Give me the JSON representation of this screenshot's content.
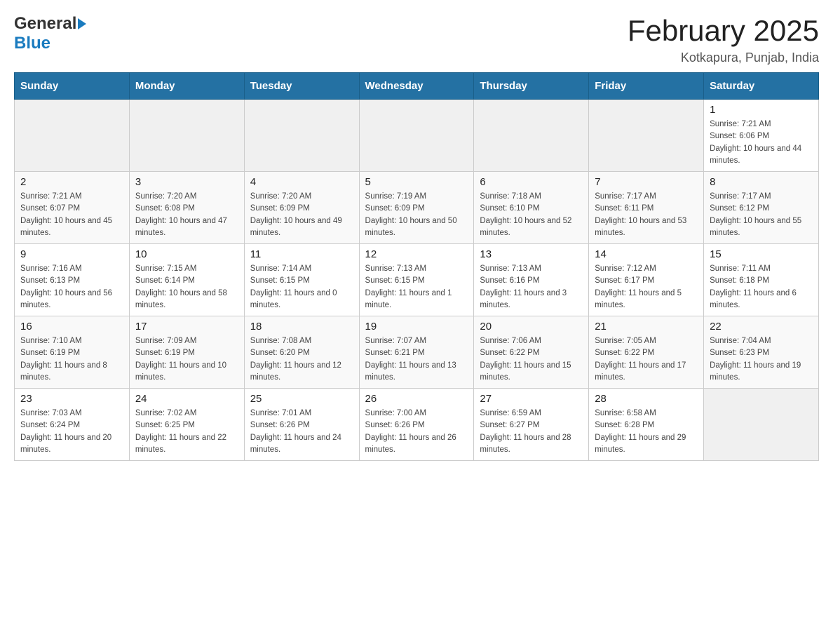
{
  "header": {
    "logo_general": "General",
    "logo_blue": "Blue",
    "month_title": "February 2025",
    "location": "Kotkapura, Punjab, India"
  },
  "weekdays": [
    "Sunday",
    "Monday",
    "Tuesday",
    "Wednesday",
    "Thursday",
    "Friday",
    "Saturday"
  ],
  "weeks": [
    [
      {
        "day": "",
        "sunrise": "",
        "sunset": "",
        "daylight": ""
      },
      {
        "day": "",
        "sunrise": "",
        "sunset": "",
        "daylight": ""
      },
      {
        "day": "",
        "sunrise": "",
        "sunset": "",
        "daylight": ""
      },
      {
        "day": "",
        "sunrise": "",
        "sunset": "",
        "daylight": ""
      },
      {
        "day": "",
        "sunrise": "",
        "sunset": "",
        "daylight": ""
      },
      {
        "day": "",
        "sunrise": "",
        "sunset": "",
        "daylight": ""
      },
      {
        "day": "1",
        "sunrise": "Sunrise: 7:21 AM",
        "sunset": "Sunset: 6:06 PM",
        "daylight": "Daylight: 10 hours and 44 minutes."
      }
    ],
    [
      {
        "day": "2",
        "sunrise": "Sunrise: 7:21 AM",
        "sunset": "Sunset: 6:07 PM",
        "daylight": "Daylight: 10 hours and 45 minutes."
      },
      {
        "day": "3",
        "sunrise": "Sunrise: 7:20 AM",
        "sunset": "Sunset: 6:08 PM",
        "daylight": "Daylight: 10 hours and 47 minutes."
      },
      {
        "day": "4",
        "sunrise": "Sunrise: 7:20 AM",
        "sunset": "Sunset: 6:09 PM",
        "daylight": "Daylight: 10 hours and 49 minutes."
      },
      {
        "day": "5",
        "sunrise": "Sunrise: 7:19 AM",
        "sunset": "Sunset: 6:09 PM",
        "daylight": "Daylight: 10 hours and 50 minutes."
      },
      {
        "day": "6",
        "sunrise": "Sunrise: 7:18 AM",
        "sunset": "Sunset: 6:10 PM",
        "daylight": "Daylight: 10 hours and 52 minutes."
      },
      {
        "day": "7",
        "sunrise": "Sunrise: 7:17 AM",
        "sunset": "Sunset: 6:11 PM",
        "daylight": "Daylight: 10 hours and 53 minutes."
      },
      {
        "day": "8",
        "sunrise": "Sunrise: 7:17 AM",
        "sunset": "Sunset: 6:12 PM",
        "daylight": "Daylight: 10 hours and 55 minutes."
      }
    ],
    [
      {
        "day": "9",
        "sunrise": "Sunrise: 7:16 AM",
        "sunset": "Sunset: 6:13 PM",
        "daylight": "Daylight: 10 hours and 56 minutes."
      },
      {
        "day": "10",
        "sunrise": "Sunrise: 7:15 AM",
        "sunset": "Sunset: 6:14 PM",
        "daylight": "Daylight: 10 hours and 58 minutes."
      },
      {
        "day": "11",
        "sunrise": "Sunrise: 7:14 AM",
        "sunset": "Sunset: 6:15 PM",
        "daylight": "Daylight: 11 hours and 0 minutes."
      },
      {
        "day": "12",
        "sunrise": "Sunrise: 7:13 AM",
        "sunset": "Sunset: 6:15 PM",
        "daylight": "Daylight: 11 hours and 1 minute."
      },
      {
        "day": "13",
        "sunrise": "Sunrise: 7:13 AM",
        "sunset": "Sunset: 6:16 PM",
        "daylight": "Daylight: 11 hours and 3 minutes."
      },
      {
        "day": "14",
        "sunrise": "Sunrise: 7:12 AM",
        "sunset": "Sunset: 6:17 PM",
        "daylight": "Daylight: 11 hours and 5 minutes."
      },
      {
        "day": "15",
        "sunrise": "Sunrise: 7:11 AM",
        "sunset": "Sunset: 6:18 PM",
        "daylight": "Daylight: 11 hours and 6 minutes."
      }
    ],
    [
      {
        "day": "16",
        "sunrise": "Sunrise: 7:10 AM",
        "sunset": "Sunset: 6:19 PM",
        "daylight": "Daylight: 11 hours and 8 minutes."
      },
      {
        "day": "17",
        "sunrise": "Sunrise: 7:09 AM",
        "sunset": "Sunset: 6:19 PM",
        "daylight": "Daylight: 11 hours and 10 minutes."
      },
      {
        "day": "18",
        "sunrise": "Sunrise: 7:08 AM",
        "sunset": "Sunset: 6:20 PM",
        "daylight": "Daylight: 11 hours and 12 minutes."
      },
      {
        "day": "19",
        "sunrise": "Sunrise: 7:07 AM",
        "sunset": "Sunset: 6:21 PM",
        "daylight": "Daylight: 11 hours and 13 minutes."
      },
      {
        "day": "20",
        "sunrise": "Sunrise: 7:06 AM",
        "sunset": "Sunset: 6:22 PM",
        "daylight": "Daylight: 11 hours and 15 minutes."
      },
      {
        "day": "21",
        "sunrise": "Sunrise: 7:05 AM",
        "sunset": "Sunset: 6:22 PM",
        "daylight": "Daylight: 11 hours and 17 minutes."
      },
      {
        "day": "22",
        "sunrise": "Sunrise: 7:04 AM",
        "sunset": "Sunset: 6:23 PM",
        "daylight": "Daylight: 11 hours and 19 minutes."
      }
    ],
    [
      {
        "day": "23",
        "sunrise": "Sunrise: 7:03 AM",
        "sunset": "Sunset: 6:24 PM",
        "daylight": "Daylight: 11 hours and 20 minutes."
      },
      {
        "day": "24",
        "sunrise": "Sunrise: 7:02 AM",
        "sunset": "Sunset: 6:25 PM",
        "daylight": "Daylight: 11 hours and 22 minutes."
      },
      {
        "day": "25",
        "sunrise": "Sunrise: 7:01 AM",
        "sunset": "Sunset: 6:26 PM",
        "daylight": "Daylight: 11 hours and 24 minutes."
      },
      {
        "day": "26",
        "sunrise": "Sunrise: 7:00 AM",
        "sunset": "Sunset: 6:26 PM",
        "daylight": "Daylight: 11 hours and 26 minutes."
      },
      {
        "day": "27",
        "sunrise": "Sunrise: 6:59 AM",
        "sunset": "Sunset: 6:27 PM",
        "daylight": "Daylight: 11 hours and 28 minutes."
      },
      {
        "day": "28",
        "sunrise": "Sunrise: 6:58 AM",
        "sunset": "Sunset: 6:28 PM",
        "daylight": "Daylight: 11 hours and 29 minutes."
      },
      {
        "day": "",
        "sunrise": "",
        "sunset": "",
        "daylight": ""
      }
    ]
  ]
}
